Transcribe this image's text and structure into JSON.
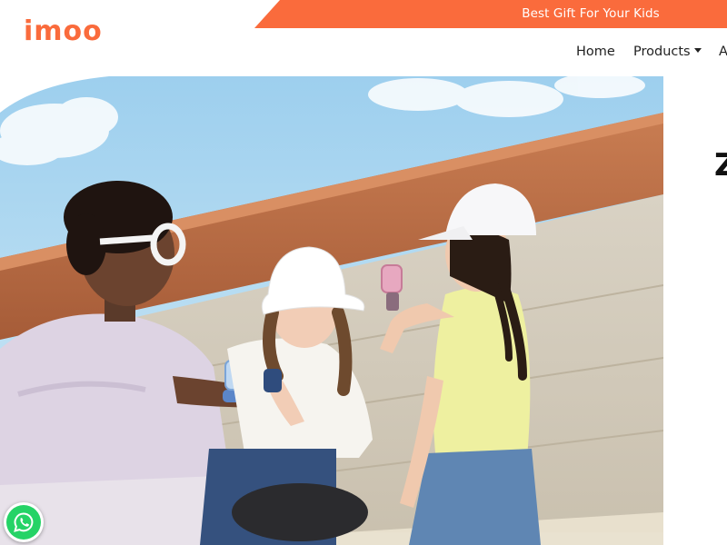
{
  "header": {
    "logo": "imoo",
    "promo_text": "Best Gift For Your Kids",
    "brand_color": "#fa6b3c"
  },
  "nav": {
    "items": [
      {
        "label": "Home"
      },
      {
        "label": "Products"
      },
      {
        "label": "A"
      }
    ]
  },
  "hero": {
    "side_heading": "Z"
  },
  "floating": {
    "whatsapp_icon": "whatsapp-icon",
    "whatsapp_color": "#25d366"
  }
}
